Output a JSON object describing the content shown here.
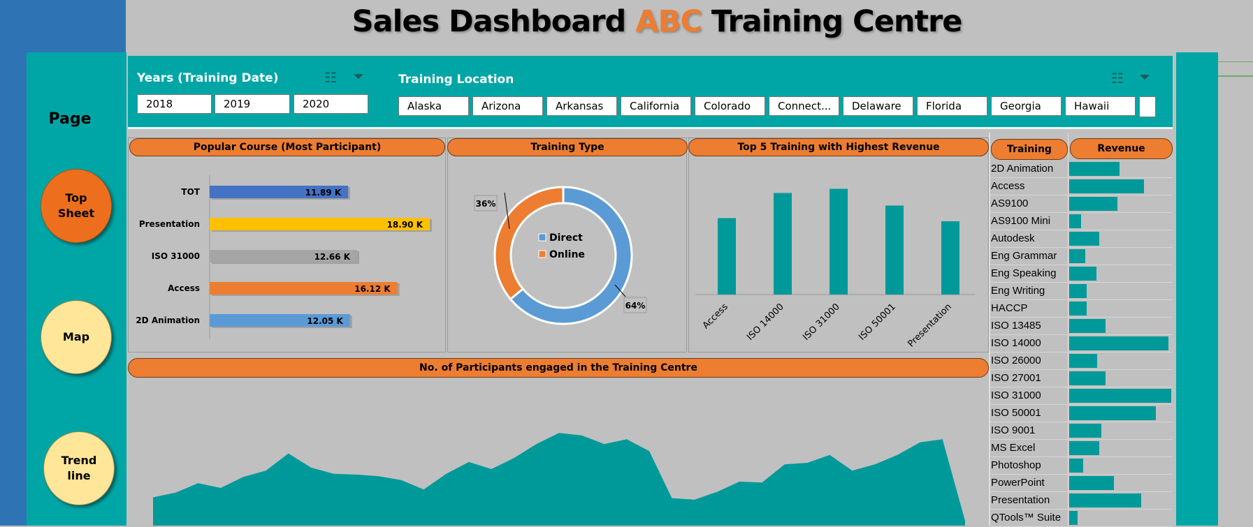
{
  "header": {
    "title_before": "Sales Dashboard ",
    "title_brand": "ABC",
    "title_after": " Training Centre"
  },
  "nav": {
    "page_label": "Page",
    "top_sheet": [
      "Top",
      "Sheet"
    ],
    "map": "Map",
    "trend_line": [
      "Trend",
      "line"
    ]
  },
  "slicers": {
    "years": {
      "title": "Years (Training Date)",
      "items": [
        "2018",
        "2019",
        "2020"
      ]
    },
    "location": {
      "title": "Training Location",
      "items": [
        "Alaska",
        "Arizona",
        "Arkansas",
        "California",
        "Colorado",
        "Connect...",
        "Delaware",
        "Florida",
        "Georgia",
        "Hawaii"
      ]
    },
    "icons": [
      "multi-select-icon",
      "clear-filter-icon"
    ]
  },
  "panels": {
    "popular_course": "Popular Course (Most Participant)",
    "training_type": "Training Type",
    "top5": "Top 5 Training with Highest Revenue",
    "participants": "No. of Participants engaged in the Training Centre",
    "training_col": "Training",
    "revenue_col": "Revenue"
  },
  "colors": {
    "teal": "#00a6a6",
    "orange": "#ed7d31",
    "bar_teal": "#009999",
    "direct": "#5b9bd5",
    "online": "#ed7d31"
  },
  "chart_data": [
    {
      "type": "bar",
      "title": "Popular Course (Most Participant)",
      "orientation": "horizontal",
      "categories": [
        "TOT",
        "Presentation",
        "ISO 31000",
        "Access",
        "2D Animation"
      ],
      "values": [
        11.89,
        18.9,
        12.66,
        16.12,
        12.05
      ],
      "labels": [
        "11.89 K",
        "18.90 K",
        "12.66 K",
        "16.12 K",
        "12.05 K"
      ],
      "colors": [
        "#4472c4",
        "#ffc000",
        "#a5a5a5",
        "#ed7d31",
        "#5b9bd5"
      ],
      "xlim": [
        0,
        24
      ]
    },
    {
      "type": "pie",
      "title": "Training Type",
      "donut": true,
      "series": [
        {
          "name": "Direct",
          "value": 64,
          "label": "64%"
        },
        {
          "name": "Online",
          "value": 36,
          "label": "36%"
        }
      ],
      "legend": "center"
    },
    {
      "type": "bar",
      "title": "Top 5 Training with Highest Revenue",
      "categories": [
        "Access",
        "ISO 14000",
        "ISO 31000",
        "ISO 50001",
        "Presentation"
      ],
      "values": [
        73,
        97,
        101,
        85,
        70
      ],
      "ylim": [
        0,
        110
      ]
    },
    {
      "type": "bar",
      "title": "Revenue",
      "orientation": "horizontal",
      "categories": [
        "2D Animation",
        "Access",
        "AS9100",
        "AS9100 Mini",
        "Autodesk",
        "Eng Grammar",
        "Eng Speaking",
        "Eng Writing",
        "HACCP",
        "ISO 13485",
        "ISO 14000",
        "ISO 26000",
        "ISO 27001",
        "ISO 31000",
        "ISO 50001",
        "ISO 9001",
        "MS Excel",
        "Photoshop",
        "PowerPoint",
        "Presentation",
        "QTools™ Suite"
      ],
      "values": [
        50,
        74,
        48,
        12,
        30,
        16,
        27,
        17,
        17,
        36,
        98,
        28,
        36,
        101,
        86,
        32,
        30,
        14,
        44,
        71,
        8
      ],
      "xlim": [
        0,
        101
      ]
    },
    {
      "type": "area",
      "title": "No. of Participants engaged in the Training Centre",
      "x": [
        1,
        2,
        3,
        4,
        5,
        6,
        7,
        8,
        9,
        10,
        11,
        12,
        13,
        14,
        15,
        16,
        17,
        18,
        19,
        20,
        21,
        22,
        23,
        24,
        25,
        26,
        27,
        28,
        29,
        30,
        31,
        32,
        33,
        34,
        35,
        36,
        37
      ],
      "values": [
        36,
        42,
        54,
        48,
        62,
        70,
        92,
        74,
        66,
        65,
        63,
        58,
        46,
        66,
        81,
        72,
        86,
        104,
        118,
        115,
        104,
        110,
        95,
        35,
        33,
        43,
        56,
        55,
        78,
        80,
        90,
        70,
        78,
        90,
        106,
        110,
        6
      ],
      "ylim": [
        0,
        185
      ]
    }
  ]
}
